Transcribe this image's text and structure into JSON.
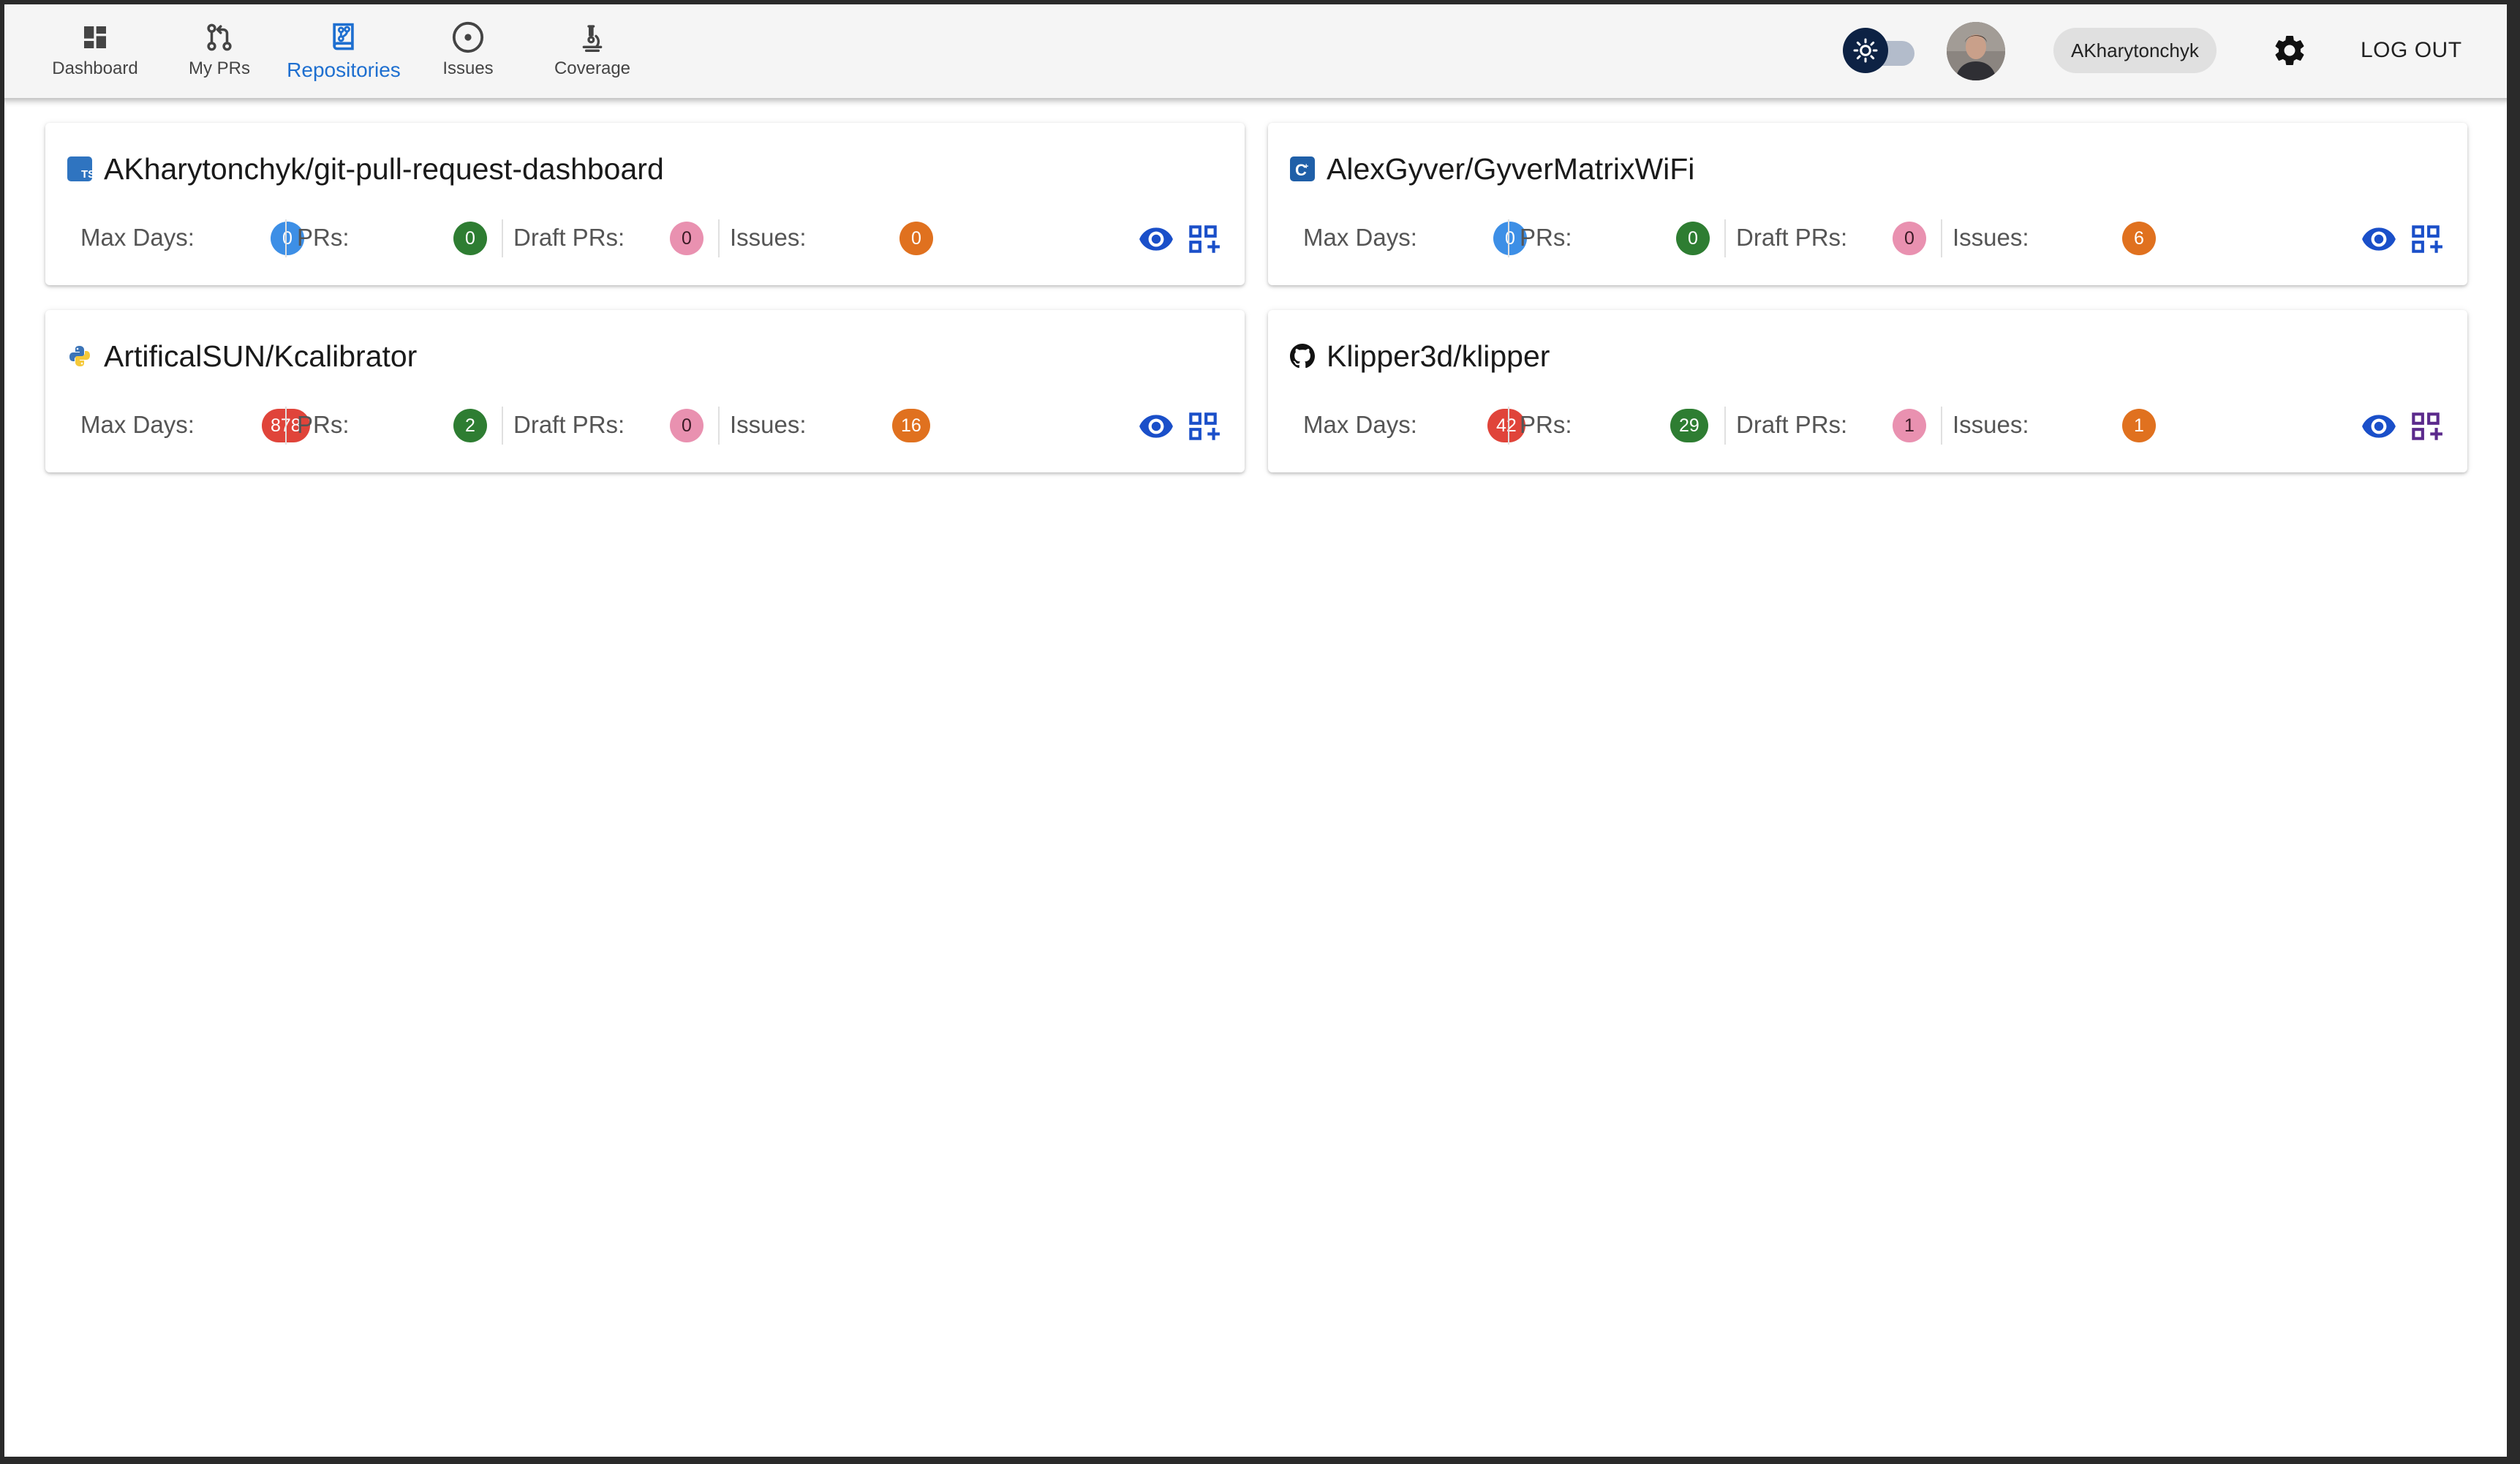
{
  "nav": {
    "items": [
      {
        "label": "Dashboard",
        "icon": "dashboard-icon"
      },
      {
        "label": "My PRs",
        "icon": "pull-request-icon"
      },
      {
        "label": "Repositories",
        "icon": "repository-icon",
        "active": true
      },
      {
        "label": "Issues",
        "icon": "issue-circle-icon"
      },
      {
        "label": "Coverage",
        "icon": "microscope-icon"
      }
    ]
  },
  "header": {
    "theme_toggle_icon": "sun-icon",
    "username": "AKharytonchyk",
    "settings_icon": "gear-icon",
    "logout_label": "LOG OUT"
  },
  "labels": {
    "max_days": "Max Days:",
    "prs": "PRs:",
    "draft_prs": "Draft PRs:",
    "issues": "Issues:"
  },
  "repos": [
    {
      "name": "AKharytonchyk/git-pull-request-dashboard",
      "language_icon": "typescript-icon",
      "max_days": "0",
      "prs": "0",
      "draft_prs": "0",
      "issues": "0",
      "max_days_color": "#3d8fe6"
    },
    {
      "name": "AlexGyver/GyverMatrixWiFi",
      "language_icon": "cpp-icon",
      "max_days": "0",
      "prs": "0",
      "draft_prs": "0",
      "issues": "6",
      "max_days_color": "#3d8fe6"
    },
    {
      "name": "ArtificalSUN/Kcalibrator",
      "language_icon": "python-icon",
      "max_days": "878",
      "prs": "2",
      "draft_prs": "0",
      "issues": "16",
      "max_days_color": "#e0443a"
    },
    {
      "name": "Klipper3d/klipper",
      "language_icon": "github-icon",
      "max_days": "42",
      "prs": "29",
      "draft_prs": "1",
      "issues": "1",
      "max_days_color": "#e0443a"
    }
  ],
  "colors": {
    "accent": "#1e6fd0",
    "prs_badge": "#2e7d32",
    "draft_badge": "#e991b0",
    "issues_badge": "#e0711f",
    "max_days_ok": "#3d8fe6",
    "max_days_stale": "#e0443a",
    "action_icon": "#1a4fc9"
  }
}
